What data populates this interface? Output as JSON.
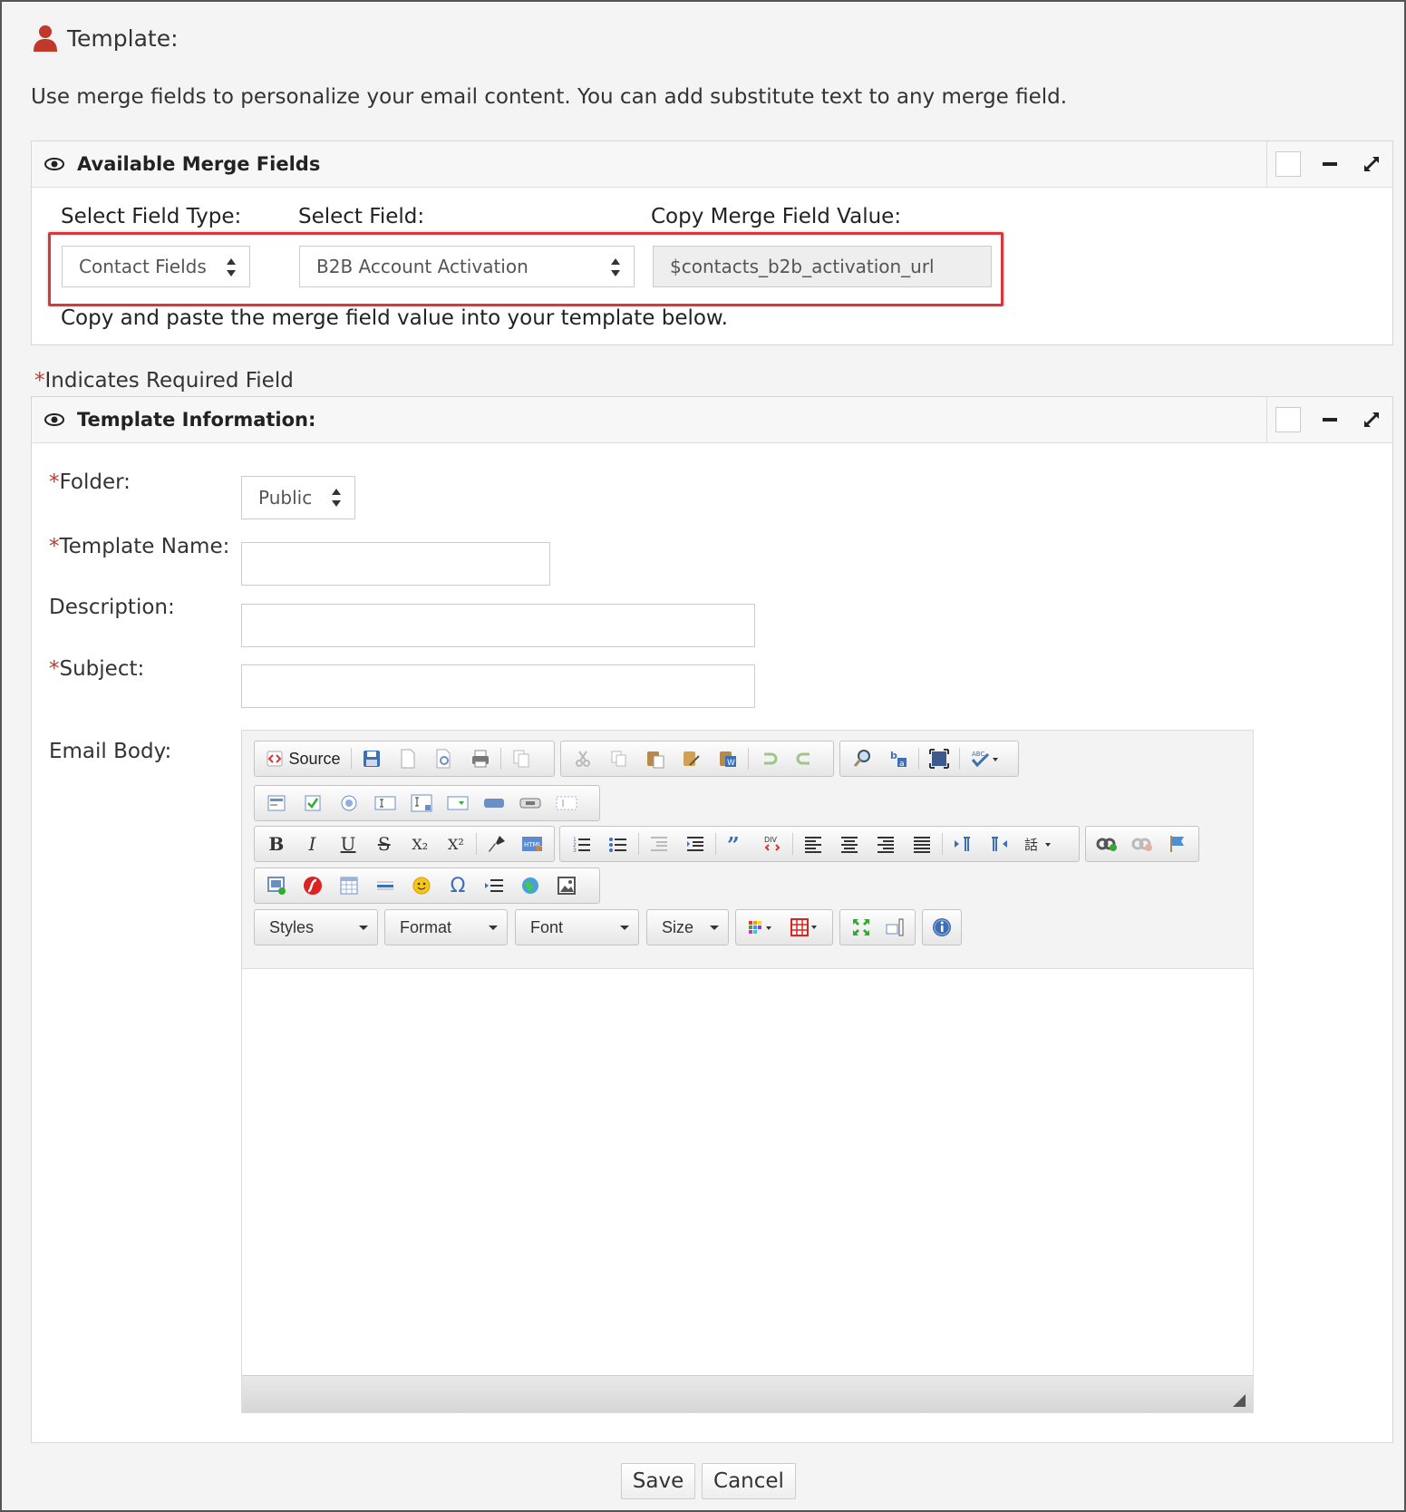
{
  "header": {
    "title": "Template:"
  },
  "intro": "Use merge fields to personalize your email content. You can add substitute text to any merge field.",
  "merge_panel": {
    "title": "Available Merge Fields",
    "field_type_label": "Select Field Type:",
    "field_label": "Select Field:",
    "copy_label": "Copy Merge Field Value:",
    "field_type_value": "Contact Fields",
    "field_value": "B2B Account Activation",
    "copy_value": "$contacts_b2b_activation_url",
    "hint": "Copy and paste the merge field value into your template below."
  },
  "required_note": {
    "star": "*",
    "text": "Indicates Required Field"
  },
  "template_panel": {
    "title": "Template Information:",
    "folder_label": "Folder:",
    "folder_value": "Public",
    "name_label": "Template Name:",
    "description_label": "Description:",
    "subject_label": "Subject:",
    "body_label": "Email Body:",
    "star": "*"
  },
  "editor": {
    "source_label": "Source",
    "combos": [
      "Styles",
      "Format",
      "Font",
      "Size"
    ],
    "bold": "B",
    "italic": "I",
    "underline": "U",
    "strike": "S",
    "subscript": "X₂",
    "superscript": "X²",
    "omega": "Ω"
  },
  "actions": {
    "save": "Save",
    "cancel": "Cancel"
  },
  "colors": {
    "accent_red": "#d9373a",
    "required_red": "#c0392b",
    "user_icon": "#c0392b"
  }
}
